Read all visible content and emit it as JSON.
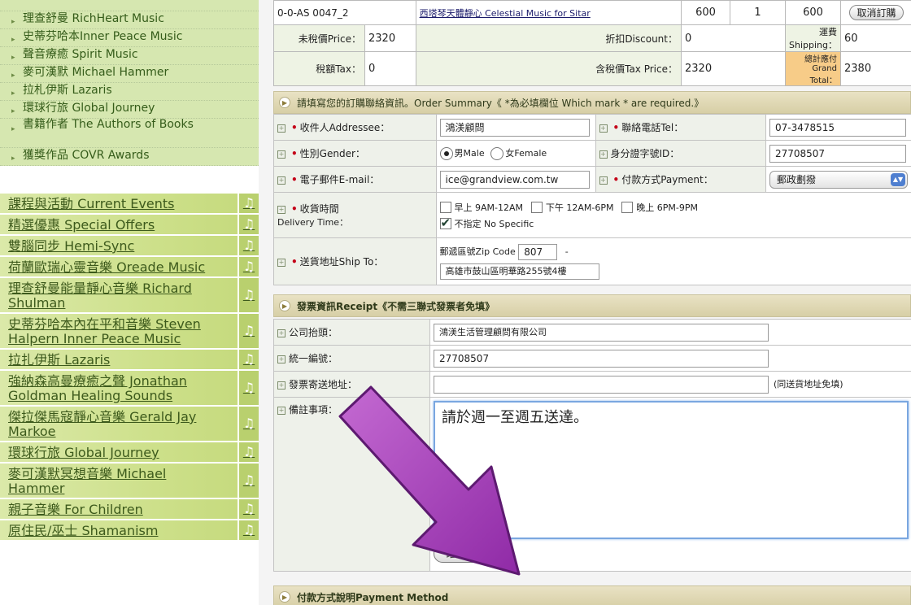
{
  "sidebar": {
    "sub_items": [
      {
        "label": "理查舒曼 RichHeart Music"
      },
      {
        "label": "史蒂芬哈本Inner Peace Music"
      },
      {
        "label": "聲音療癒 Spirit Music"
      },
      {
        "label": "麥可漢默 Michael Hammer"
      },
      {
        "label": "拉札伊斯 Lazaris"
      },
      {
        "label": "環球行旅 Global Journey"
      },
      {
        "label": "書籍作者 The Authors of Books"
      },
      {
        "label": "獲獎作品 COVR Awards"
      }
    ],
    "main_items": [
      {
        "label": "課程與活動 Current Events"
      },
      {
        "label": "精選優惠 Special Offers"
      },
      {
        "label": "雙腦同步 Hemi-Sync"
      },
      {
        "label": "荷蘭歐瑞心靈音樂 Oreade Music"
      },
      {
        "label": "理查舒曼能量靜心音樂 Richard Shulman"
      },
      {
        "label": "史蒂芬哈本內在平和音樂 Steven Halpern Inner Peace Music"
      },
      {
        "label": "拉扎伊斯 Lazaris"
      },
      {
        "label": "強納森高曼療癒之聲 Jonathan Goldman Healing Sounds"
      },
      {
        "label": "傑拉傑馬寇靜心音樂 Gerald Jay Markoe"
      },
      {
        "label": "環球行旅 Global Journey"
      },
      {
        "label": "麥可漢默冥想音樂 Michael Hammer"
      },
      {
        "label": "親子音樂 For Children"
      },
      {
        "label": "原住民/巫士 Shamanism"
      }
    ],
    "note_icon": "♫"
  },
  "order": {
    "item": {
      "code": "0-0-AS 0047_2",
      "title": "西塔琴天體靜心 Celestial Music for Sitar",
      "price": "600",
      "qty": "1",
      "subtotal": "600",
      "cancel_label": "取消訂購"
    },
    "summary": {
      "pretax_label": "未稅價Price：",
      "pretax_value": "2320",
      "discount_label": "折扣Discount：",
      "discount_value": "0",
      "shipping_label": "運費Shipping：",
      "shipping_value": "60",
      "tax_label": "稅額Tax：",
      "tax_value": "0",
      "taxprice_label": "含稅價Tax Price：",
      "taxprice_value": "2320",
      "grand_label": "總計應付Grand Total：",
      "grand_value": "2380"
    }
  },
  "contact": {
    "header": "請填寫您的訂購聯絡資訊。Order Summary《 *為必填欄位 Which mark * are required.》",
    "addressee_label": "收件人Addressee：",
    "addressee_value": "鴻渼顧問",
    "tel_label": "聯絡電話Tel：",
    "tel_value": "07-3478515",
    "gender_label": "性別Gender：",
    "gender_male": "男Male",
    "gender_female": "女Female",
    "id_label": "身分證字號ID：",
    "id_value": "27708507",
    "email_label": "電子郵件E-mail：",
    "email_value": "ice@grandview.com.tw",
    "payment_label": "付款方式Payment：",
    "payment_value": "郵政劃撥",
    "delivery_label": "收貨時間",
    "delivery_label_en": "Delivery Time：",
    "delivery_opt1": "早上 9AM-12AM",
    "delivery_opt2": "下午 12AM-6PM",
    "delivery_opt3": "晚上 6PM-9PM",
    "delivery_opt4": "不指定 No Specific",
    "shipto_label": "送貨地址Ship To：",
    "zip_label": "郵遞區號Zip Code",
    "zip_value": "807",
    "zip_dash": "-",
    "address_value": "高雄市鼓山區明華路255號4樓"
  },
  "receipt": {
    "header": "發票資訊Receipt《不需三聯式發票者免填》",
    "company_label": "公司抬頭：",
    "company_value": "鴻渼生活管理顧問有限公司",
    "taxid_label": "統一編號：",
    "taxid_value": "27708507",
    "mail_label": "發票寄送地址：",
    "mail_value": "",
    "mail_note": "(同送貨地址免填)",
    "remark_label": "備註事項：",
    "remark_value": "請於週一至週五送達。",
    "ok_label": "確定 / OK"
  },
  "payment_method": {
    "header": "付款方式說明Payment Method"
  },
  "colors": {
    "annotation_arrow": "#a43fb6",
    "sidebar_green": "#cde08a",
    "grand_total_highlight": "#f7cc88"
  }
}
